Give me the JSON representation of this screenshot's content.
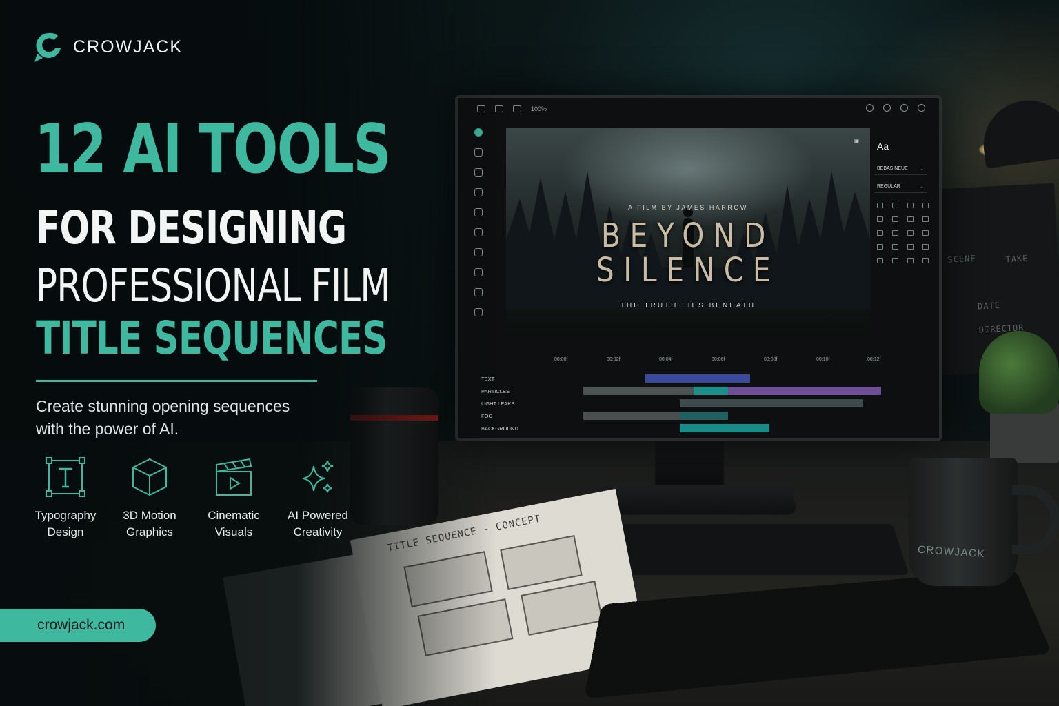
{
  "brand": {
    "name": "CROWJACK",
    "accent": "#3fb8a0"
  },
  "headline": {
    "line1": "12 AI TOOLS",
    "line2": "FOR DESIGNING",
    "line3": "PROFESSIONAL FILM",
    "line4": "TITLE SEQUENCES"
  },
  "subtitle": {
    "line1": "Create stunning opening sequences",
    "line2": "with the power of AI."
  },
  "features": [
    {
      "icon": "typography-icon",
      "line1": "Typography",
      "line2": "Design"
    },
    {
      "icon": "cube-icon",
      "line1": "3D Motion",
      "line2": "Graphics"
    },
    {
      "icon": "clapperboard-icon",
      "line1": "Cinematic",
      "line2": "Visuals"
    },
    {
      "icon": "sparkle-icon",
      "line1": "AI Powered",
      "line2": "Creativity"
    }
  ],
  "cta": {
    "label": "crowjack.com"
  },
  "editor": {
    "zoom": "100%",
    "preview": {
      "credit": "A FILM BY JAMES HARROW",
      "title_line1": "BEYOND",
      "title_line2": "SILENCE",
      "tagline": "THE TRUTH LIES BENEATH"
    },
    "properties": {
      "sample": "Aa",
      "font": "BEBAS NEUE",
      "weight": "REGULAR"
    },
    "timeline": {
      "ticks": [
        "00:00f",
        "00:02f",
        "00:04f",
        "00:06f",
        "00:08f",
        "00:10f",
        "00:12f"
      ],
      "tracks": [
        {
          "label": "TEXT",
          "color": "#3b4a9c"
        },
        {
          "label": "PARTICLES",
          "color": "#6e4e95"
        },
        {
          "label": "LIGHT LEAKS",
          "color": "#3e4a4c"
        },
        {
          "label": "FOG",
          "color": "#4a4f50"
        },
        {
          "label": "BACKGROUND",
          "color": "#168c88"
        }
      ]
    }
  },
  "props": {
    "notebook_title": "TITLE SEQUENCE - CONCEPT",
    "mug_brand": "CROWJACK",
    "clapper_scene": "SCENE",
    "clapper_take": "TAKE",
    "clapper_date": "DATE",
    "clapper_director": "DIRECTOR"
  }
}
